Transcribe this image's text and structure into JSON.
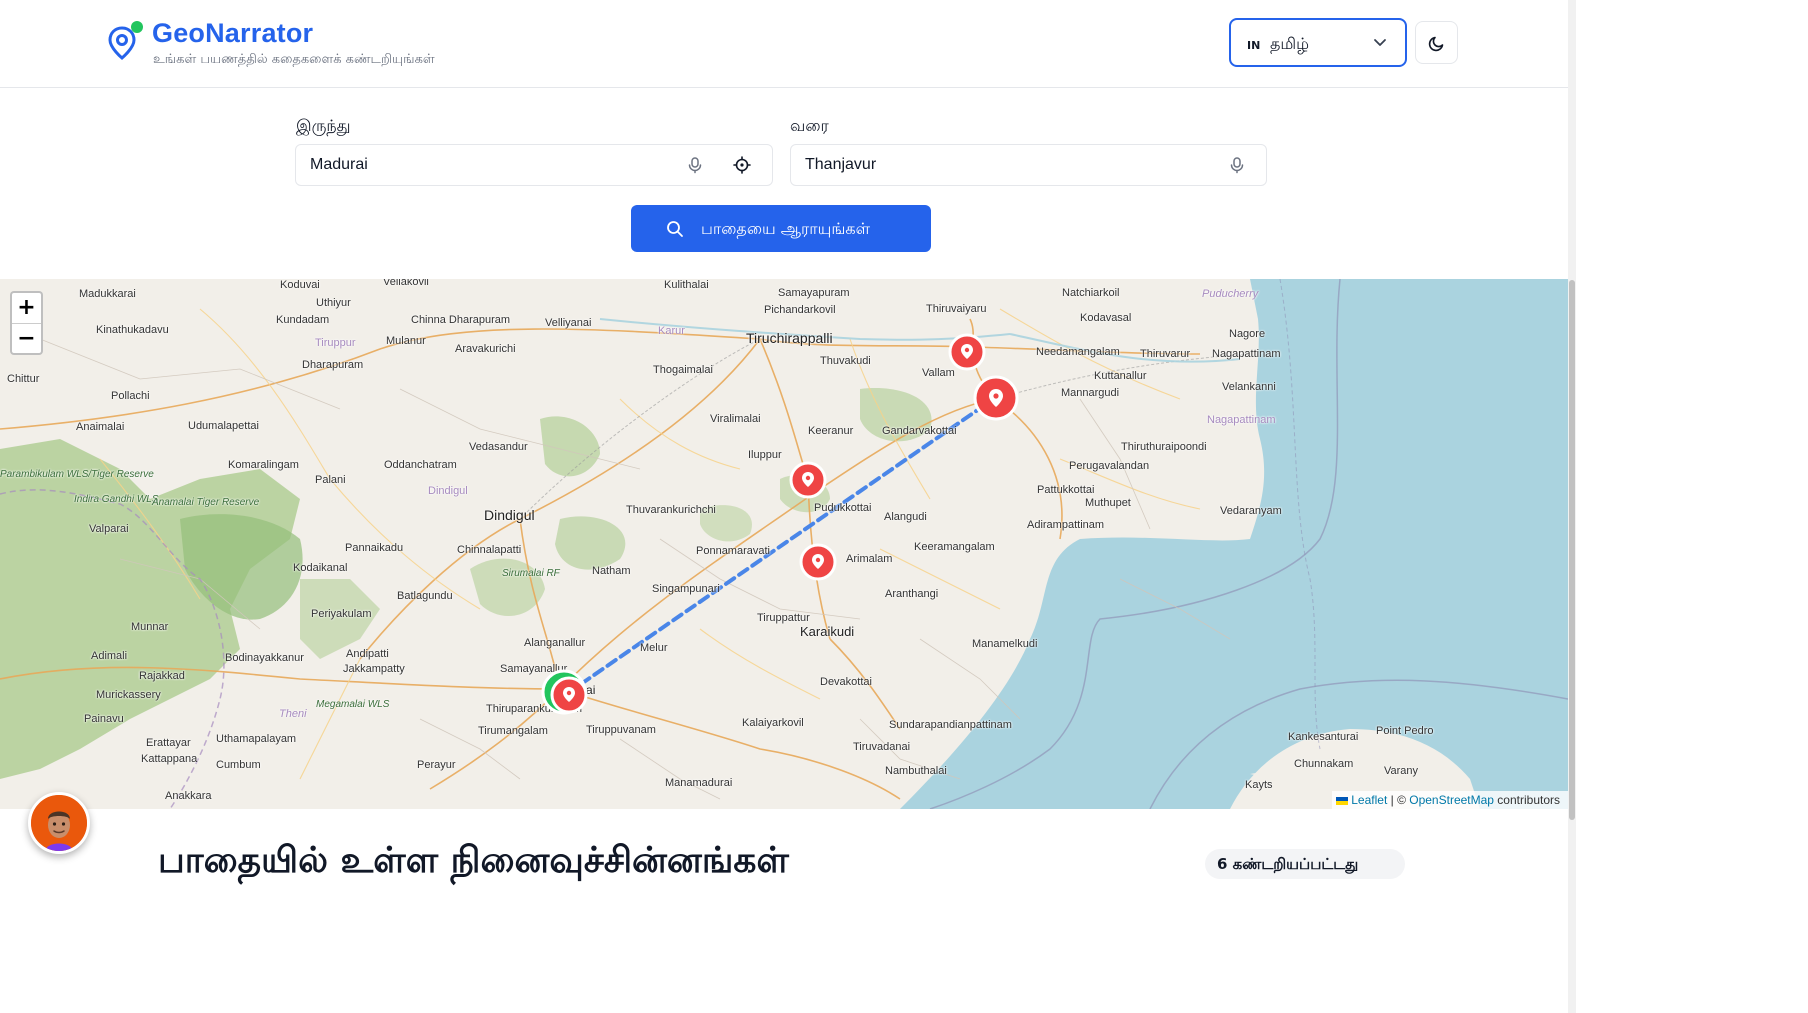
{
  "header": {
    "brand": "GeoNarrator",
    "tagline": "உங்கள் பயணத்தில் கதைகளைக் கண்டறியுங்கள்",
    "language": {
      "code": "IN",
      "name": "தமிழ்"
    },
    "theme_icon": "moon-icon"
  },
  "search": {
    "from_label": "இருந்து",
    "from_value": "Madurai",
    "to_label": "வரை",
    "to_value": "Thanjavur",
    "explore_label": "பாதையை ஆராயுங்கள்"
  },
  "map": {
    "zoom_in": "+",
    "zoom_out": "−",
    "attribution": {
      "leaflet": "Leaflet",
      "separator": " | © ",
      "osm": "OpenStreetMap",
      "suffix": " contributors"
    },
    "cities": [
      "Tiruchirappalli",
      "Dindigul",
      "Karaikudi",
      "Madurai"
    ],
    "places": [
      "Madukkarai",
      "Koduvai",
      "Vellakovil",
      "Uthiyur",
      "Kundadam",
      "Chinna Dharapuram",
      "Velliyanai",
      "Kulithalai",
      "Samayapuram",
      "Pichandarkovil",
      "Thiruvaiyaru",
      "Natchiarkoil",
      "Puducherry",
      "Kodavasal",
      "Nagore",
      "Kinathukadavu",
      "Tiruppur",
      "Mulanur",
      "Aravakurichi",
      "Karur",
      "Thuvakudi",
      "Vallam",
      "Needamangalam",
      "Thiruvarur",
      "Nagapattinam",
      "Chittur",
      "Dharapuram",
      "Thogaimalai",
      "Kuttanallur",
      "Velankanni",
      "Pollachi",
      "Mannargudi",
      "Anaimalai",
      "Udumalapettai",
      "Viralimalai",
      "Keeranur",
      "Gandarvakottai",
      "Nagapattinam",
      "Iluppur",
      "Thiruthuraipoondi",
      "Vedasandur",
      "Komaralingam",
      "Oddanchatram",
      "Perugavalandan",
      "Palani",
      "Pattukkottai",
      "Dindigul",
      "Muthupet",
      "Thuvarankurichchi",
      "Pudukkottai",
      "Alangudi",
      "Vedaranyam",
      "Valparai",
      "Adirampattinam",
      "Pannaikadu",
      "Chinnalapatti",
      "Ponnamaravati",
      "Keeramangalam",
      "Kodaikanal",
      "Natham",
      "Arimalam",
      "Sirumalai RF",
      "Singampunari",
      "Aranthangi",
      "Batlagundu",
      "Periyakulam",
      "Tiruppattur",
      "Alanganallur",
      "Munnar",
      "Manamelkudi",
      "Adimali",
      "Bodinayakkanur",
      "Andipatti",
      "Melur",
      "Jakkampatty",
      "Samayanallur",
      "Rajakkad",
      "Devakottai",
      "Murickassery",
      "Megamalai WLS",
      "Thiruparankundram",
      "Painavu",
      "Theni",
      "Kalaiyarkovil",
      "Sundarapandianpattinam",
      "Uthamapalayam",
      "Tirumangalam",
      "Tiruppuvanam",
      "Erattayar",
      "Kattappana",
      "Cumbum",
      "Tiruvadanai",
      "Kankesanturai",
      "Point Pedro",
      "Perayur",
      "Nambuthalai",
      "Chunnakam",
      "Varany",
      "Anakkara",
      "Manamadurai",
      "Kayts",
      "Indira Gandhi WLS",
      "Anamalai Tiger Reserve",
      "Parambikulam WLS/Tiger Reserve"
    ],
    "markers": [
      "start-marker",
      "end-marker",
      "landmark-marker"
    ]
  },
  "landmarks": {
    "title": "பாதையில் உள்ள நினைவுச்சின்னங்கள்",
    "count": "6 கண்டறியப்பட்டது"
  },
  "colors": {
    "brand": "#2563eb",
    "marker_red": "#ef4444",
    "marker_start": "#22c55e",
    "route": "#3b82f6",
    "sea": "#aad3df",
    "forest": "#a8c98a"
  }
}
